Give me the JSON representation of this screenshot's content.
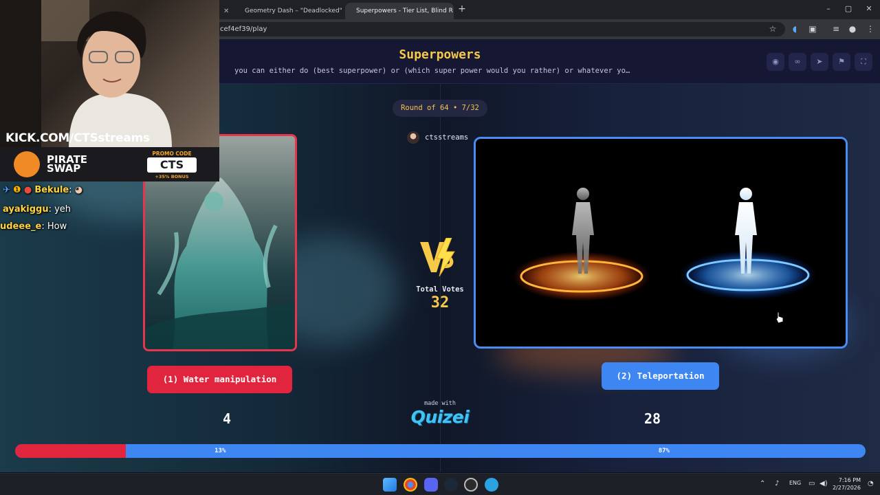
{
  "browser": {
    "tabs": [
      {
        "label": "Geometry Dash – \"Deadlocked\""
      },
      {
        "label": "Superpowers - Tier List, Blind R"
      }
    ],
    "url": "cef4ef39/play"
  },
  "header": {
    "title": "Superpowers",
    "subtitle": "you can either do (best superpower) or (which super power would you rather) or whatever yo…"
  },
  "game": {
    "round_label": "Round of 64 • 7/32",
    "creator": "ctsstreams",
    "total_votes_label": "Total Votes",
    "total_votes": "32",
    "left_option": {
      "label": "(1) Water manipulation",
      "votes": "4",
      "percent_label": "13%",
      "percent": 13
    },
    "right_option": {
      "label": "(2) Teleportation",
      "votes": "28",
      "percent_label": "87%",
      "percent": 87
    },
    "made_with": "made with",
    "brand": "Quizei"
  },
  "overlay": {
    "kick_prefix": "KICK.COM/",
    "kick_channel": "CTSstreams",
    "sponsor_name_1": "PIRATE",
    "sponsor_name_2": "SWAP",
    "promo_label": "PROMO CODE",
    "promo_code": "CTS",
    "promo_bonus": "+35% BONUS",
    "chat": [
      {
        "user": "Bekule",
        "text": ""
      },
      {
        "user": "ayakiggu",
        "text": "yeh"
      },
      {
        "user": "udeee_e",
        "text": "How"
      }
    ]
  },
  "taskbar": {
    "lang": "ENG",
    "time": "7:16 PM",
    "date": "2/27/2026"
  },
  "colors": {
    "accent_gold": "#f7c948",
    "left_red": "#e1253f",
    "right_blue": "#3e87f2"
  }
}
